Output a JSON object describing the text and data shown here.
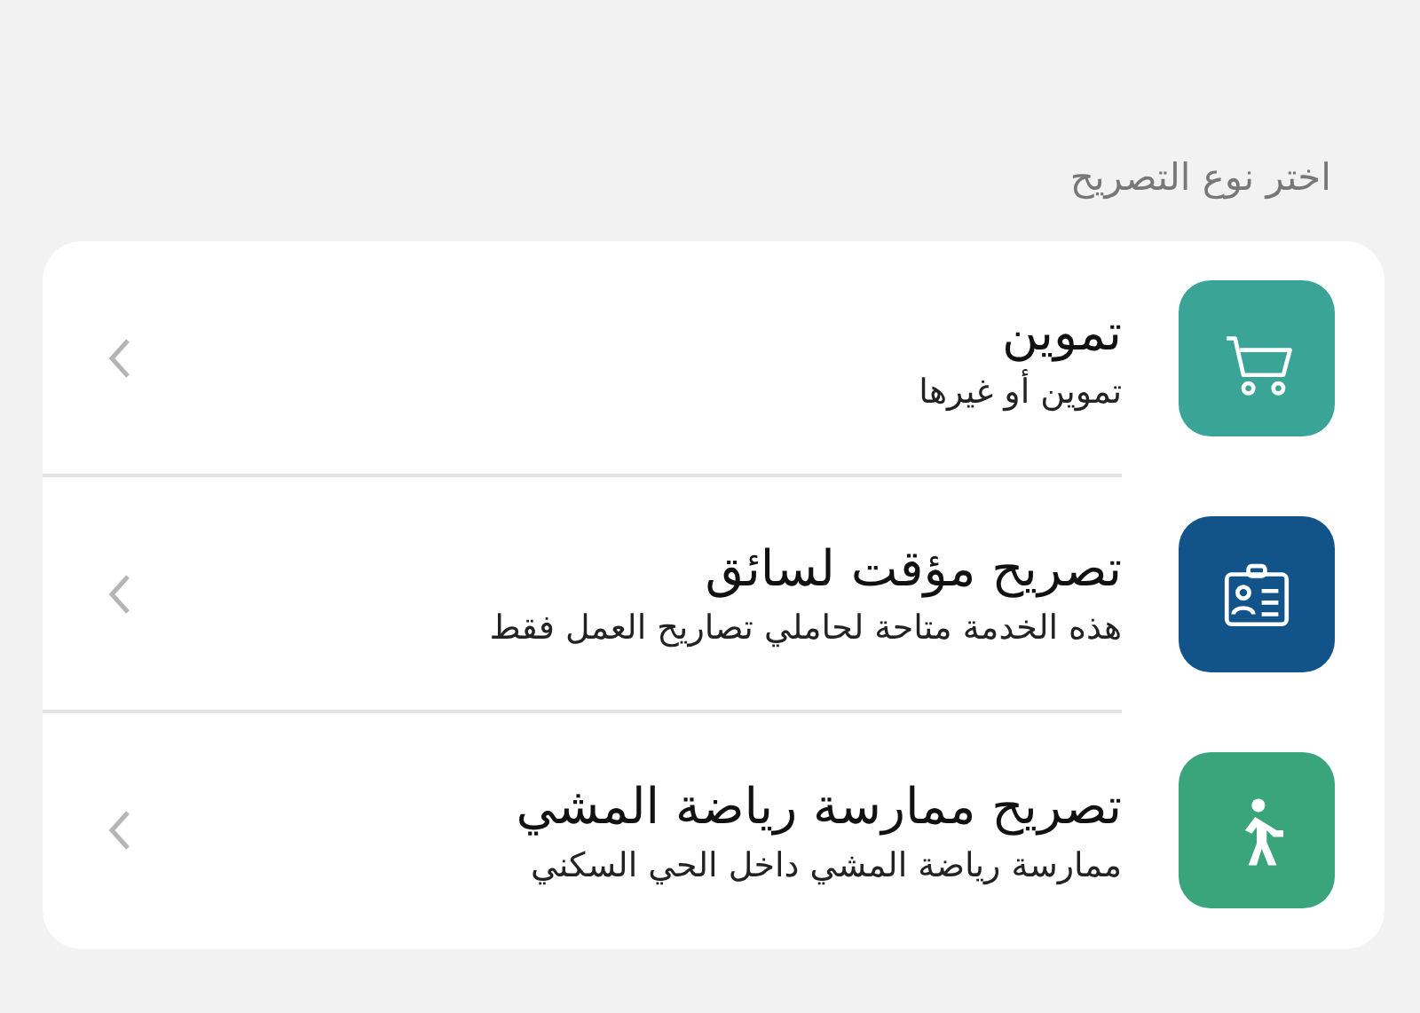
{
  "section_title": "اختر نوع التصريح",
  "options": [
    {
      "title": "تموين",
      "subtitle": "تموين أو غيرها",
      "kind": "cart",
      "color": "#3aa596"
    },
    {
      "title": "تصريح مؤقت لسائق",
      "subtitle": "هذه الخدمة متاحة لحاملي تصاريح العمل فقط",
      "kind": "badge",
      "color": "#12538a"
    },
    {
      "title": "تصريح ممارسة رياضة المشي",
      "subtitle": "ممارسة رياضة المشي داخل الحي السكني",
      "kind": "walk",
      "color": "#3aa57a"
    }
  ]
}
